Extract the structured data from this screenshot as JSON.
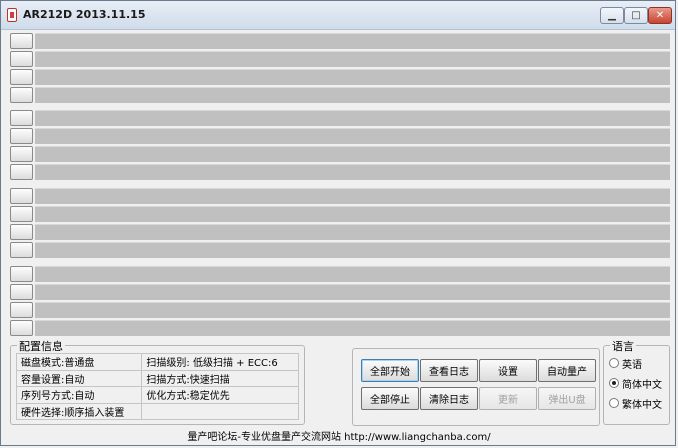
{
  "window": {
    "title": "AR212D 2013.11.15"
  },
  "config": {
    "title": "配置信息",
    "left": [
      "磁盘模式:普通盘",
      "容量设置:自动",
      "序列号方式:自动",
      "硬件选择:顺序插入装置"
    ],
    "right": [
      "扫描级别: 低级扫描 + ECC:6",
      "扫描方式:快速扫描",
      "优化方式:稳定优先",
      ""
    ]
  },
  "buttons": {
    "start_all": "全部开始",
    "view_log": "查看日志",
    "settings": "设置",
    "auto_mass": "自动量产",
    "stop_all": "全部停止",
    "clear_log": "清除日志",
    "update": "更新",
    "eject": "弹出U盘"
  },
  "language": {
    "title": "语言",
    "options": [
      "英语",
      "简体中文",
      "繁体中文"
    ],
    "selected": "简体中文"
  },
  "footer": {
    "text": "量产吧论坛-专业优盘量产交流网站 http://www.liangchanba.com/"
  }
}
